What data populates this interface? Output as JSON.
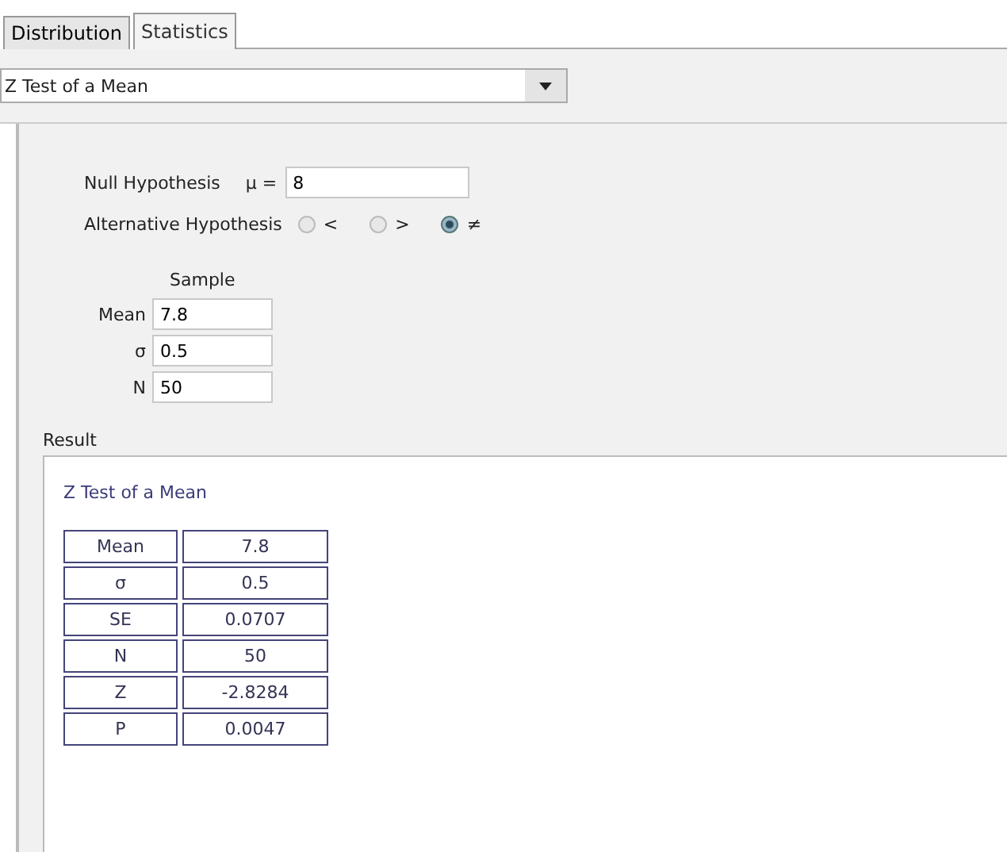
{
  "tabs": [
    {
      "label": "Distribution",
      "selected": false
    },
    {
      "label": "Statistics",
      "selected": true
    }
  ],
  "test_select": {
    "value": "Z Test of a Mean"
  },
  "null_hypothesis": {
    "label": "Null Hypothesis",
    "symbol": "μ =",
    "value": "8"
  },
  "alternative_hypothesis": {
    "label": "Alternative Hypothesis",
    "options": [
      {
        "label": "<",
        "selected": false
      },
      {
        "label": ">",
        "selected": false
      },
      {
        "label": "≠",
        "selected": true
      }
    ]
  },
  "sample": {
    "heading": "Sample",
    "fields": [
      {
        "label": "Mean",
        "value": "7.8"
      },
      {
        "label": "σ",
        "value": "0.5"
      },
      {
        "label": "N",
        "value": "50"
      }
    ]
  },
  "result": {
    "label": "Result",
    "title": "Z Test of a Mean",
    "rows": [
      {
        "name": "Mean",
        "value": "7.8"
      },
      {
        "name": "σ",
        "value": "0.5"
      },
      {
        "name": "SE",
        "value": "0.0707"
      },
      {
        "name": "N",
        "value": "50"
      },
      {
        "name": "Z",
        "value": "-2.8284"
      },
      {
        "name": "P",
        "value": "0.0047"
      }
    ]
  }
}
